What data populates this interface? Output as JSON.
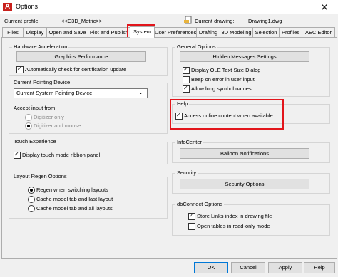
{
  "window": {
    "title": "Options",
    "close_glyph": "✕"
  },
  "profile": {
    "label": "Current profile:",
    "value": "<<C3D_Metric>>"
  },
  "drawing": {
    "label": "Current drawing:",
    "value": "Drawing1.dwg"
  },
  "tabs": [
    "Files",
    "Display",
    "Open and Save",
    "Plot and Publish",
    "System",
    "User Preferences",
    "Drafting",
    "3D Modeling",
    "Selection",
    "Profiles",
    "AEC Editor"
  ],
  "active_tab": "System",
  "hardware": {
    "title": "Hardware Acceleration",
    "button": "Graphics Performance",
    "auto_check": "Automatically check for certification update"
  },
  "pointing": {
    "title": "Current Pointing Device",
    "select_value": "Current System Pointing Device",
    "accept_label": "Accept input from:",
    "opt1": "Digitizer only",
    "opt2": "Digitizer and mouse"
  },
  "touch": {
    "title": "Touch Experience",
    "option": "Display touch mode ribbon panel"
  },
  "regen": {
    "title": "Layout Regen Options",
    "opt1": "Regen when switching layouts",
    "opt2": "Cache model tab and last layout",
    "opt3": "Cache model tab and all layouts"
  },
  "general": {
    "title": "General Options",
    "button": "Hidden Messages Settings",
    "opt1": "Display OLE Text Size Dialog",
    "opt2": "Beep on error in user input",
    "opt3": "Allow long symbol names"
  },
  "help": {
    "title": "Help",
    "option": "Access online content when available"
  },
  "infocenter": {
    "title": "InfoCenter",
    "button": "Balloon Notifications"
  },
  "security": {
    "title": "Security",
    "button": "Security Options"
  },
  "dbconnect": {
    "title": "dbConnect Options",
    "opt1": "Store Links index in drawing file",
    "opt2": "Open tables in read-only mode"
  },
  "footer": {
    "ok": "OK",
    "cancel": "Cancel",
    "apply": "Apply",
    "help": "Help"
  },
  "colors": {
    "highlight": "#e2151b",
    "accent": "#0078d7"
  }
}
